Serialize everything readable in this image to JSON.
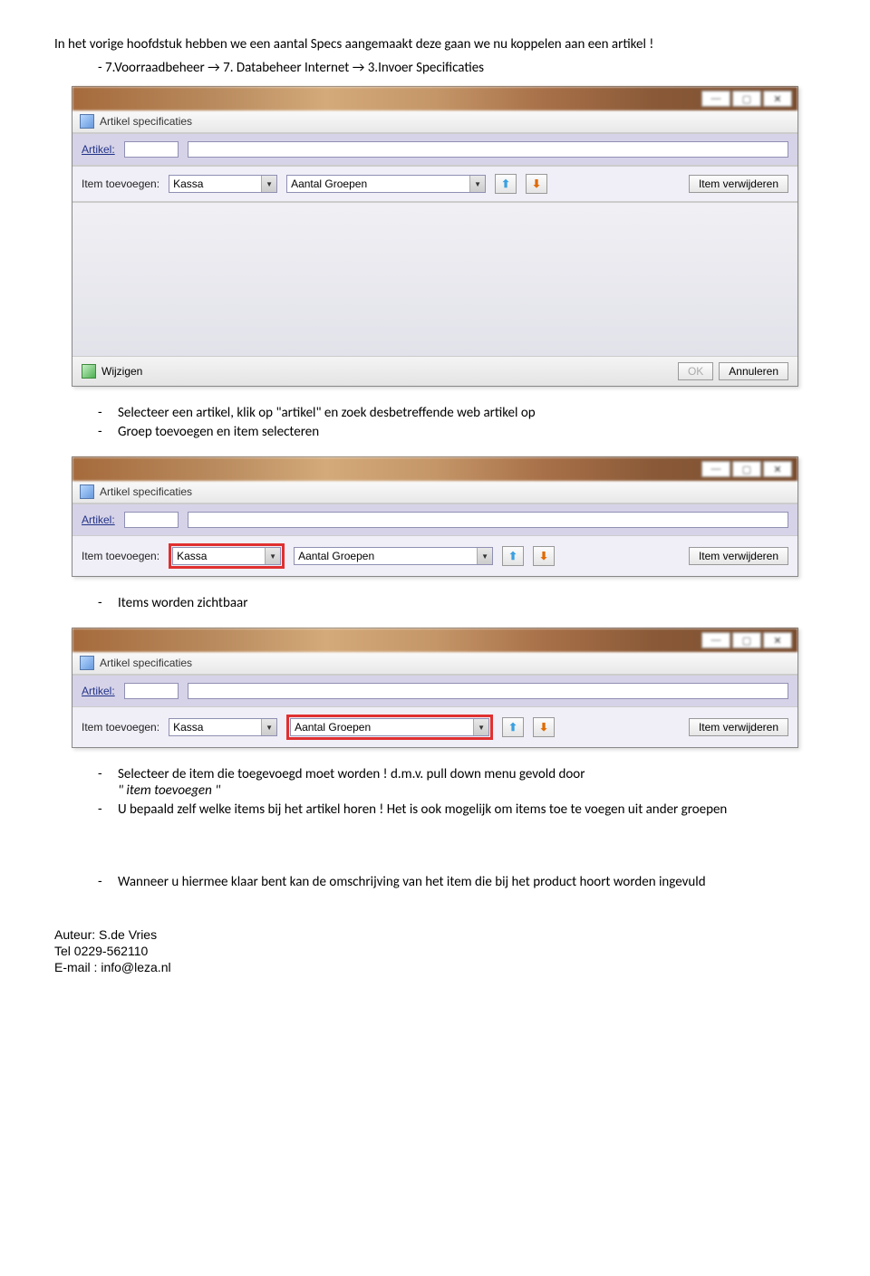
{
  "intro_para": "In het vorige hoofdstuk hebben we een aantal  Specs aangemaakt deze gaan we nu koppelen aan een artikel !",
  "nav_path": "-    7.Voorraadbeheer → 7. Databeheer Internet → 3.Invoer Specificaties",
  "dialog": {
    "title": "Artikel specificaties",
    "artikel_label": "Artikel:",
    "item_toevoegen_label": "Item toevoegen:",
    "dd1_value": "Kassa",
    "dd2_value": "Aantal Groepen",
    "btn_item_verwijderen": "Item verwijderen",
    "btn_wijzigen": "Wijzigen",
    "btn_ok": "OK",
    "btn_annuleren": "Annuleren"
  },
  "bullets1": [
    "Selecteer een artikel, klik op \"artikel\" en zoek desbetreffende web artikel op",
    "Groep toevoegen en item selecteren"
  ],
  "bullets2": [
    "Items worden zichtbaar"
  ],
  "bullets3a_main": "Selecteer de item die toegevoegd moet worden ! d.m.v. pull down menu gevold door",
  "bullets3a_italic": "\" item toevoegen \"",
  "bullets3b": "U bepaald zelf welke items bij het artikel horen ! Het is ook mogelijk om items toe te voegen uit ander groepen",
  "bullets4": [
    "Wanneer u hiermee klaar bent kan de omschrijving van het item die bij het product hoort worden ingevuld"
  ],
  "footer": {
    "author": "Auteur: S.de Vries",
    "tel": "Tel 0229-562110",
    "email": "E-mail : info@leza.nl"
  }
}
